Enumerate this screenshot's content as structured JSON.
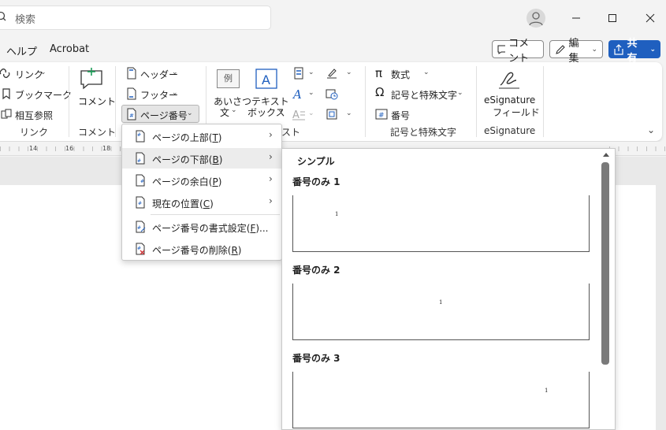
{
  "search": {
    "placeholder": "検索"
  },
  "menu": {
    "help": "ヘルプ",
    "acrobat": "Acrobat"
  },
  "header_buttons": {
    "comment": "コメント",
    "edit": "編集",
    "share": "共有"
  },
  "ribbon": {
    "link": {
      "link": "リンク",
      "bookmark": "ブックマーク",
      "crossref": "相互参照",
      "group": "リンク"
    },
    "comment": {
      "comment": "コメント",
      "group": "コメント"
    },
    "header_footer": {
      "header": "ヘッダー",
      "footer": "フッター",
      "page_number": "ページ番号"
    },
    "text": {
      "greeting_line1": "あいさつ",
      "greeting_line2": "文",
      "greeting_icon": "例",
      "textbox_line1": "テキスト",
      "textbox_line2": "ボックス",
      "group": "テキスト"
    },
    "symbols": {
      "equation": "数式",
      "symbol": "記号と特殊文字",
      "number": "番号",
      "group": "記号と特殊文字"
    },
    "esign": {
      "field_line1": "eSignature",
      "field_line2": "フィールド",
      "group": "eSignature"
    }
  },
  "ruler": {
    "ticks": [
      "14",
      "16",
      "18"
    ]
  },
  "page_number_menu": {
    "items": [
      {
        "label": "ページの上部(",
        "key": "T",
        "tail": ")"
      },
      {
        "label": "ページの下部(",
        "key": "B",
        "tail": ")"
      },
      {
        "label": "ページの余白(",
        "key": "P",
        "tail": ")"
      },
      {
        "label": "現在の位置(",
        "key": "C",
        "tail": ")"
      },
      {
        "label": "ページ番号の書式設定(",
        "key": "F",
        "tail": ")..."
      },
      {
        "label": "ページ番号の削除(",
        "key": "R",
        "tail": ")"
      }
    ]
  },
  "gallery": {
    "section": "シンプル",
    "items": [
      {
        "title": "番号のみ 1",
        "number": "1"
      },
      {
        "title": "番号のみ 2",
        "number": "1"
      },
      {
        "title": "番号のみ 3",
        "number": "1"
      }
    ]
  },
  "colors": {
    "share_button": "#1f5fbf",
    "ribbon_bg": "#ffffff",
    "window_bg": "#f3f3f3"
  }
}
